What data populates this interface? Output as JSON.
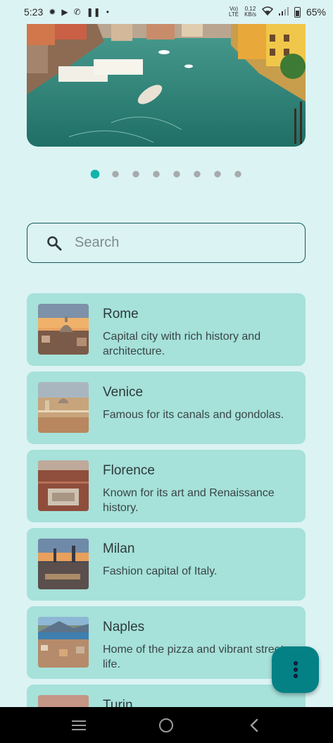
{
  "status_bar": {
    "time": "5:23",
    "volte_top": "Vo)",
    "volte_bottom": "LTE",
    "speed_value": "0.12",
    "speed_unit": "KB/s",
    "battery": "65%"
  },
  "carousel": {
    "page_count": 8,
    "active_index": 0
  },
  "search": {
    "placeholder": "Search",
    "value": ""
  },
  "cities": [
    {
      "name": "Rome",
      "description": "Capital city with rich history and architecture."
    },
    {
      "name": "Venice",
      "description": "Famous for its canals and gondolas."
    },
    {
      "name": "Florence",
      "description": "Known for its art and Renaissance history."
    },
    {
      "name": "Milan",
      "description": "Fashion capital of Italy."
    },
    {
      "name": "Naples",
      "description": "Home of the pizza and vibrant street life."
    },
    {
      "name": "Turin",
      "description": ""
    }
  ],
  "colors": {
    "background": "#dcf3f3",
    "card": "#a6e1da",
    "accent": "#10b5aa",
    "fab": "#038185",
    "search_border": "#16595a"
  },
  "icons": {
    "fab": "more-vertical-icon",
    "search": "search-icon",
    "nav": [
      "recents-icon",
      "home-icon",
      "back-icon"
    ]
  }
}
